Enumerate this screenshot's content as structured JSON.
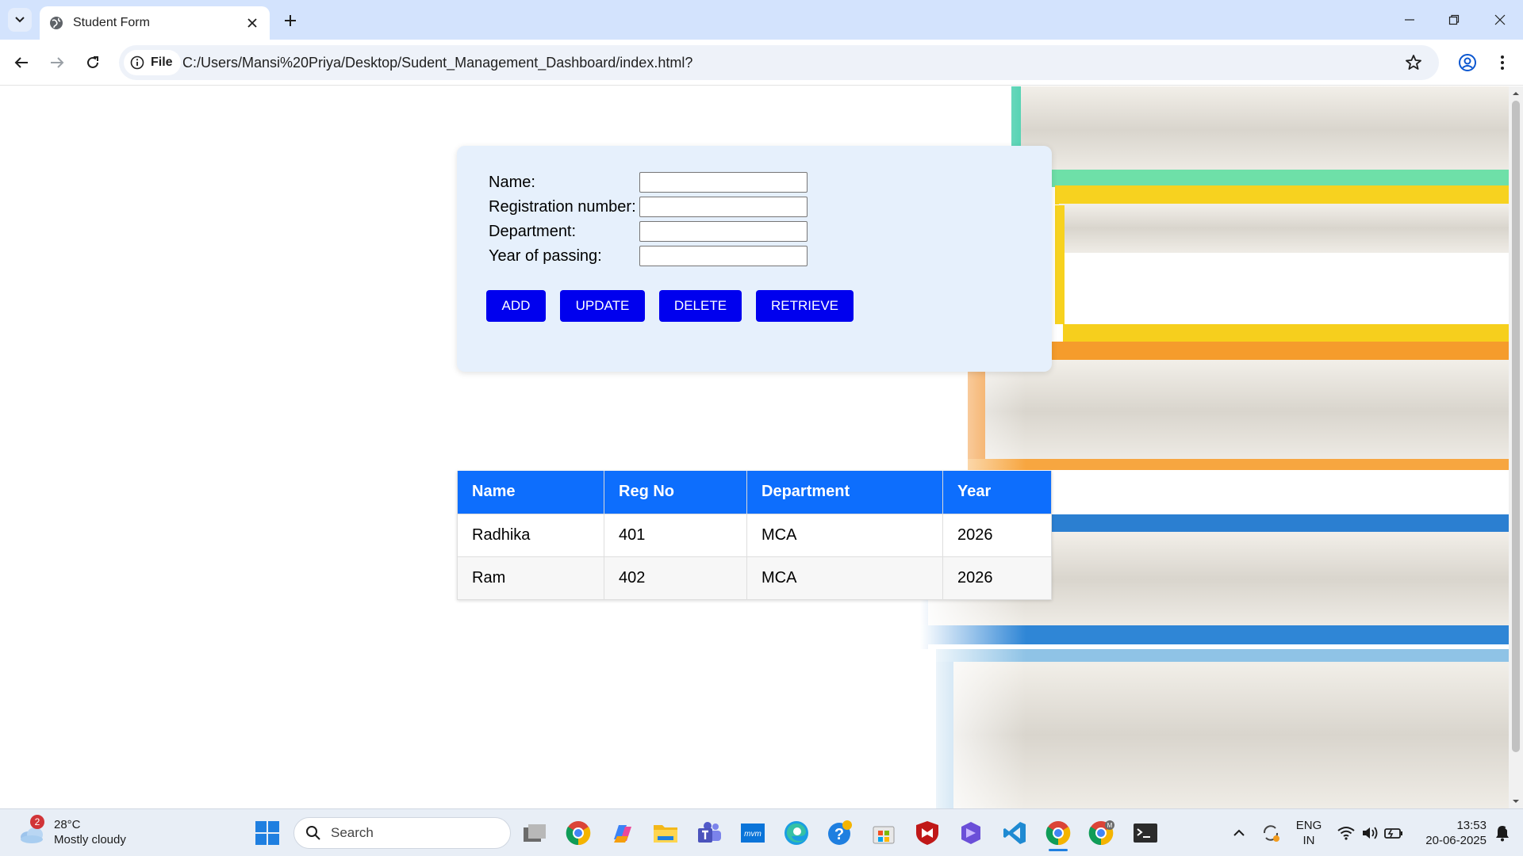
{
  "browser": {
    "tab_title": "Student Form",
    "site_chip_label": "File",
    "url": "C:/Users/Mansi%20Priya/Desktop/Sudent_Management_Dashboard/index.html?"
  },
  "form": {
    "fields": [
      {
        "label": "Name:",
        "value": ""
      },
      {
        "label": "Registration number:",
        "value": ""
      },
      {
        "label": "Department:",
        "value": ""
      },
      {
        "label": "Year of passing:",
        "value": ""
      }
    ],
    "buttons": {
      "add": "ADD",
      "update": "UPDATE",
      "delete": "DELETE",
      "retrieve": "RETRIEVE"
    }
  },
  "table": {
    "headers": [
      "Name",
      "Reg No",
      "Department",
      "Year"
    ],
    "rows": [
      [
        "Radhika",
        "401",
        "MCA",
        "2026"
      ],
      [
        "Ram",
        "402",
        "MCA",
        "2026"
      ]
    ]
  },
  "taskbar": {
    "weather_temp": "28°C",
    "weather_desc": "Mostly cloudy",
    "weather_badge": "2",
    "search_placeholder": "Search",
    "language_line1": "ENG",
    "language_line2": "IN",
    "time": "13:53",
    "date": "20-06-2025"
  },
  "colors": {
    "button_blue": "#0000ee",
    "table_header_blue": "#0d6efd",
    "form_card_bg": "#e6f0fc"
  }
}
